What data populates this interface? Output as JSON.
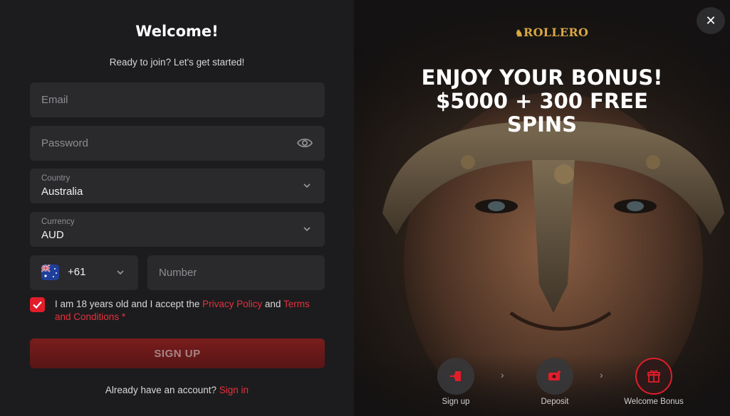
{
  "form": {
    "title": "Welcome!",
    "subtitle": "Ready to join? Let's get started!",
    "email_placeholder": "Email",
    "password_placeholder": "Password",
    "country_label": "Country",
    "country_value": "Australia",
    "currency_label": "Currency",
    "currency_value": "AUD",
    "phone_code": "+61",
    "phone_placeholder": "Number",
    "terms_prefix": "I am 18 years old and I accept the ",
    "privacy_link": "Privacy Policy",
    "terms_and": " and ",
    "terms_link": "Terms and Conditions",
    "required_mark": " *",
    "signup_label": "SIGN UP",
    "account_text": "Already have an account? ",
    "signin_link": "Sign in",
    "terms_checked": true
  },
  "promo": {
    "logo": "ROLLERO",
    "headline_line1": "ENJOY YOUR BONUS!",
    "headline_line2": "$5000 + 300 FREE",
    "headline_line3": "SPINS",
    "steps": [
      {
        "label": "Sign up",
        "icon": "signup-icon"
      },
      {
        "label": "Deposit",
        "icon": "deposit-icon"
      },
      {
        "label": "Welcome Bonus",
        "icon": "gift-icon"
      }
    ],
    "active_step": 2
  },
  "close_label": "✕",
  "colors": {
    "accent": "#e21d2a",
    "logo_gold": "#d8a743",
    "panel": "#1c1c1e",
    "field": "#2a2a2d"
  }
}
